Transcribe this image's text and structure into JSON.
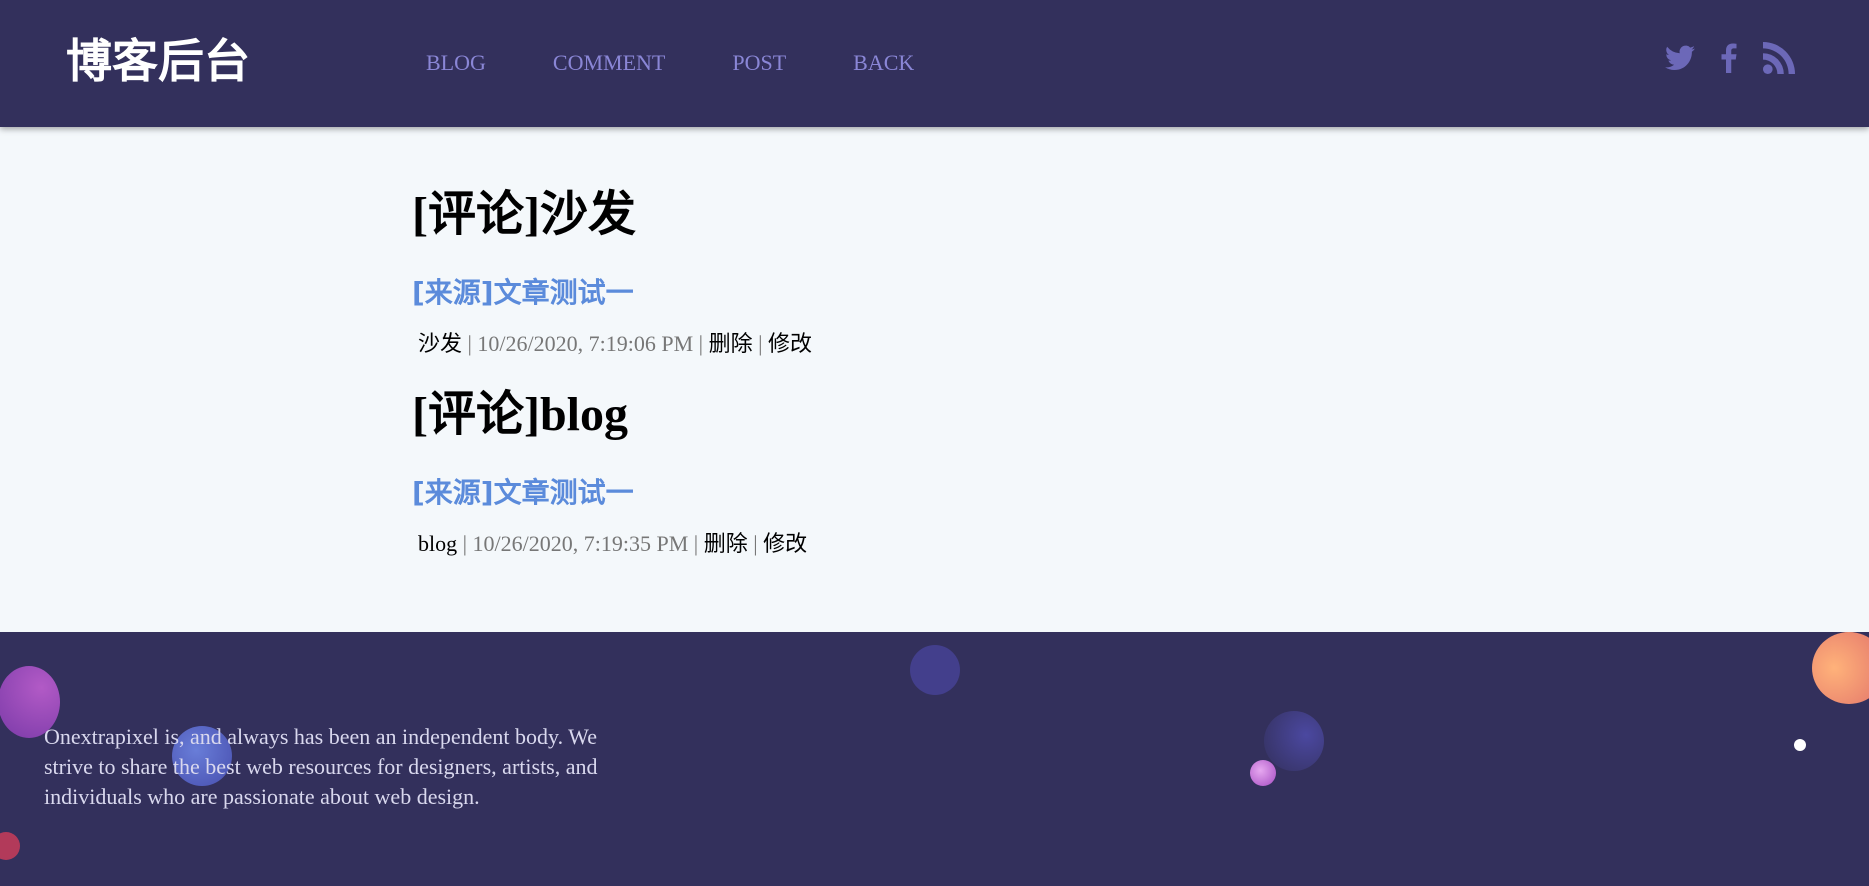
{
  "header": {
    "logo": "博客后台",
    "nav": [
      {
        "label": "BLOG"
      },
      {
        "label": "COMMENT"
      },
      {
        "label": "POST"
      },
      {
        "label": "BACK"
      }
    ],
    "social_icons": [
      "twitter-icon",
      "facebook-icon",
      "rss-icon"
    ]
  },
  "comments": [
    {
      "title": "[评论]沙发",
      "source": "[来源]文章测试一",
      "content": "沙发",
      "separator": " | ",
      "timestamp": "10/26/2020, 7:19:06 PM",
      "delete_label": "删除",
      "edit_label": "修改"
    },
    {
      "title": "[评论]blog",
      "source": "[来源]文章测试一",
      "content": "blog",
      "separator": " | ",
      "timestamp": "10/26/2020, 7:19:35 PM",
      "delete_label": "删除",
      "edit_label": "修改"
    }
  ],
  "footer": {
    "text": "Onextrapixel is, and always has been an independent body. We strive to share the best web resources for designers, artists, and individuals who are passionate about web design."
  },
  "colors": {
    "header_bg": "#33305c",
    "nav_link": "#8a86d6",
    "source_link": "#5b8bdb",
    "page_bg": "#f4f8fb"
  }
}
